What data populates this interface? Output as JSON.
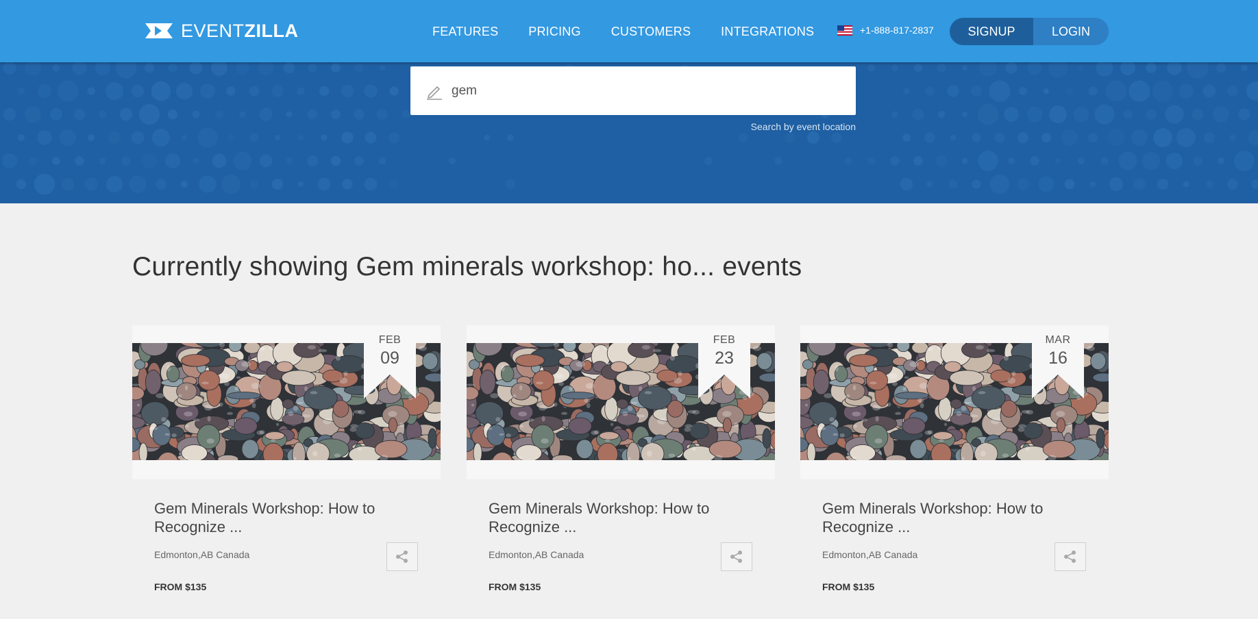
{
  "header": {
    "logo_light": "EVENT",
    "logo_bold": "ZILLA",
    "nav": [
      "FEATURES",
      "PRICING",
      "CUSTOMERS",
      "INTEGRATIONS"
    ],
    "phone": "+1-888-817-2837",
    "flag_icon": "us-flag-icon",
    "signup_label": "SIGNUP",
    "login_label": "LOGIN",
    "colors": {
      "bar": "#3399e1",
      "signup": "#1e5f9b",
      "login": "#2e7fc4"
    }
  },
  "hero": {
    "background_color": "#1f5fa3",
    "search": {
      "value": "gem",
      "icon": "pencil-icon"
    },
    "location_link": "Search by event location"
  },
  "results": {
    "heading": "Currently showing Gem minerals workshop: ho... events",
    "events": [
      {
        "month": "FEB",
        "day": "09",
        "title": "Gem Minerals Workshop: How to Recognize ...",
        "location": "Edmonton,AB Canada",
        "price": "FROM $135"
      },
      {
        "month": "FEB",
        "day": "23",
        "title": "Gem Minerals Workshop: How to Recognize ...",
        "location": "Edmonton,AB Canada",
        "price": "FROM $135"
      },
      {
        "month": "MAR",
        "day": "16",
        "title": "Gem Minerals Workshop: How to Recognize ...",
        "location": "Edmonton,AB Canada",
        "price": "FROM $135"
      }
    ]
  }
}
